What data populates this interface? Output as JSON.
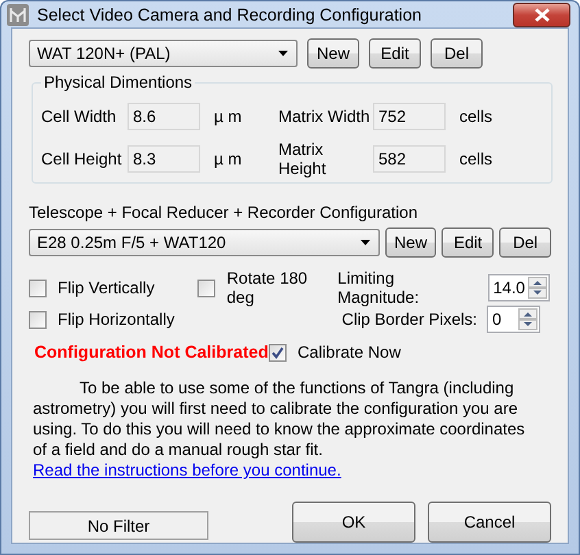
{
  "window": {
    "title": "Select Video Camera and Recording Configuration"
  },
  "camera": {
    "value": "WAT 120N+ (PAL)",
    "buttons": [
      "New",
      "Edit",
      "Del"
    ]
  },
  "physical_dimensions": {
    "title": "Physical Dimentions",
    "fields": [
      {
        "label": "Cell Width",
        "value": "8.6",
        "unit": "µ m"
      },
      {
        "label": "Matrix Width",
        "value": "752",
        "unit": "cells"
      },
      {
        "label": "Cell Height",
        "value": "8.3",
        "unit": "µ m"
      },
      {
        "label": "Matrix Height",
        "value": "582",
        "unit": "cells"
      }
    ]
  },
  "configuration": {
    "label": "Telescope + Focal Reducer + Recorder Configuration",
    "value": "E28 0.25m F/5 + WAT120",
    "buttons": [
      "New",
      "Edit",
      "Del"
    ]
  },
  "flip_vertically": {
    "label": "Flip Vertically",
    "checked": false
  },
  "rotate": {
    "label": "Rotate 180 deg",
    "checked": false
  },
  "flip_horizontally": {
    "label": "Flip Horizontally",
    "checked": false
  },
  "limiting_magnitude": {
    "label": "Limiting Magnitude:",
    "value": "14.0"
  },
  "clip_border_pixels": {
    "label": "Clip Border Pixels:",
    "value": "0"
  },
  "status": {
    "text": "Configuration Not Calibrated"
  },
  "calibrate_now": {
    "label": "Calibrate Now",
    "checked": true
  },
  "instructions": {
    "text": "To be able to use some of the functions of Tangra (including astrometry) you will first need to calibrate the configuration you are using. To do this you will need to know the approximate coordinates of a field and do a manual rough star fit.",
    "link": "Read the instructions before you continue."
  },
  "filter_button": "No Filter",
  "buttons": [
    "OK",
    "Cancel"
  ]
}
